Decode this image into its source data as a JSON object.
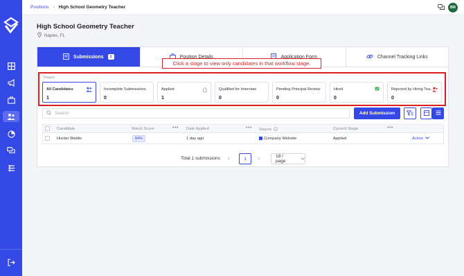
{
  "breadcrumb": {
    "parent": "Positions",
    "current": "High School Geometry Teacher"
  },
  "user": {
    "initials": "BR"
  },
  "position": {
    "title": "High School Geometry Teacher",
    "location": "Naples, FL"
  },
  "tabs": [
    {
      "label": "Submissions",
      "badge": "1",
      "active": true,
      "icon": "submissions-icon"
    },
    {
      "label": "Position Details",
      "icon": "briefcase-icon"
    },
    {
      "label": "Application Form",
      "icon": "form-icon"
    },
    {
      "label": "Channel Tracking Links",
      "icon": "link-icon"
    }
  ],
  "tooltip": "Click a stage to view only candidates in that workflow stage.",
  "stages": {
    "label": "Stages",
    "items": [
      {
        "name": "All Candidates",
        "count": "1",
        "icon": "people-icon"
      },
      {
        "name": "Incomplete Submissions",
        "count": "0"
      },
      {
        "name": "Applied",
        "count": "1",
        "icon": "hand-icon"
      },
      {
        "name": "Qualified for Interview",
        "count": "0"
      },
      {
        "name": "Pending Principal Review",
        "count": "0"
      },
      {
        "name": "Hired",
        "count": "0",
        "icon": "flag-icon"
      },
      {
        "name": "Rejected by Hiring Tea...",
        "count": "0",
        "icon": "user-x-icon"
      }
    ]
  },
  "search": {
    "placeholder": "Search"
  },
  "add_button": "Add Submission",
  "table": {
    "headers": {
      "candidate": "Candidate",
      "match_score": "Match Score",
      "date_applied": "Date Applied",
      "source": "Source",
      "current_stage": "Current Stage"
    },
    "rows": [
      {
        "candidate": "Hunter Waldis",
        "match_score": "84%",
        "date_applied": "1 day ago",
        "source": "Company Website",
        "current_stage": "Applied",
        "action": "Action"
      }
    ]
  },
  "pagination": {
    "total": "Total 1 submissions",
    "page": "1",
    "page_size": "18 / page"
  },
  "colors": {
    "brand": "#3448e6",
    "highlight": "#d92020",
    "avatar": "#1f6b3f"
  }
}
